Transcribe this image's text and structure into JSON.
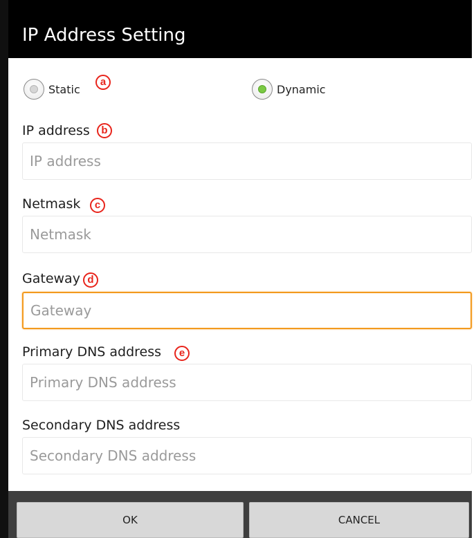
{
  "dialog": {
    "title": "IP Address Setting"
  },
  "mode": {
    "options": [
      {
        "label": "Static",
        "selected": false
      },
      {
        "label": "Dynamic",
        "selected": true
      }
    ],
    "selected_color": "#7ac943"
  },
  "fields": {
    "ip_address": {
      "label": "IP address",
      "placeholder": "IP address",
      "value": ""
    },
    "netmask": {
      "label": "Netmask",
      "placeholder": "Netmask",
      "value": ""
    },
    "gateway": {
      "label": "Gateway",
      "placeholder": "Gateway",
      "value": "",
      "focused": true
    },
    "primary_dns": {
      "label": "Primary DNS address",
      "placeholder": "Primary DNS address",
      "value": ""
    },
    "secondary_dns": {
      "label": "Secondary DNS address",
      "placeholder": "Secondary DNS address",
      "value": ""
    }
  },
  "annotations": {
    "a": "a",
    "b": "b",
    "c": "c",
    "d": "d",
    "e": "e",
    "color": "#e8241b"
  },
  "buttons": {
    "ok": "OK",
    "cancel": "CANCEL"
  },
  "colors": {
    "focus_border": "#f39a1e",
    "titlebar": "#000000",
    "footer": "#3e3e3e"
  }
}
